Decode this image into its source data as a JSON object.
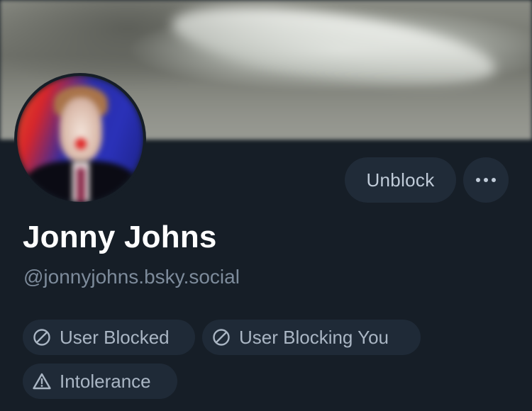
{
  "profile": {
    "display_name": "Jonny Johns",
    "handle": "@jonnyjohns.bsky.social"
  },
  "actions": {
    "unblock_label": "Unblock",
    "more_icon": "ellipsis-icon"
  },
  "labels": [
    {
      "text": "User Blocked",
      "icon": "block-icon"
    },
    {
      "text": "User Blocking You",
      "icon": "block-icon"
    },
    {
      "text": "Intolerance",
      "icon": "warning-icon"
    }
  ],
  "colors": {
    "background": "#161e27",
    "button_bg": "#202b38",
    "pill_bg": "#1f2a37",
    "name": "#ffffff",
    "handle": "#7d8b9b",
    "pill_text": "#aab6c4"
  }
}
